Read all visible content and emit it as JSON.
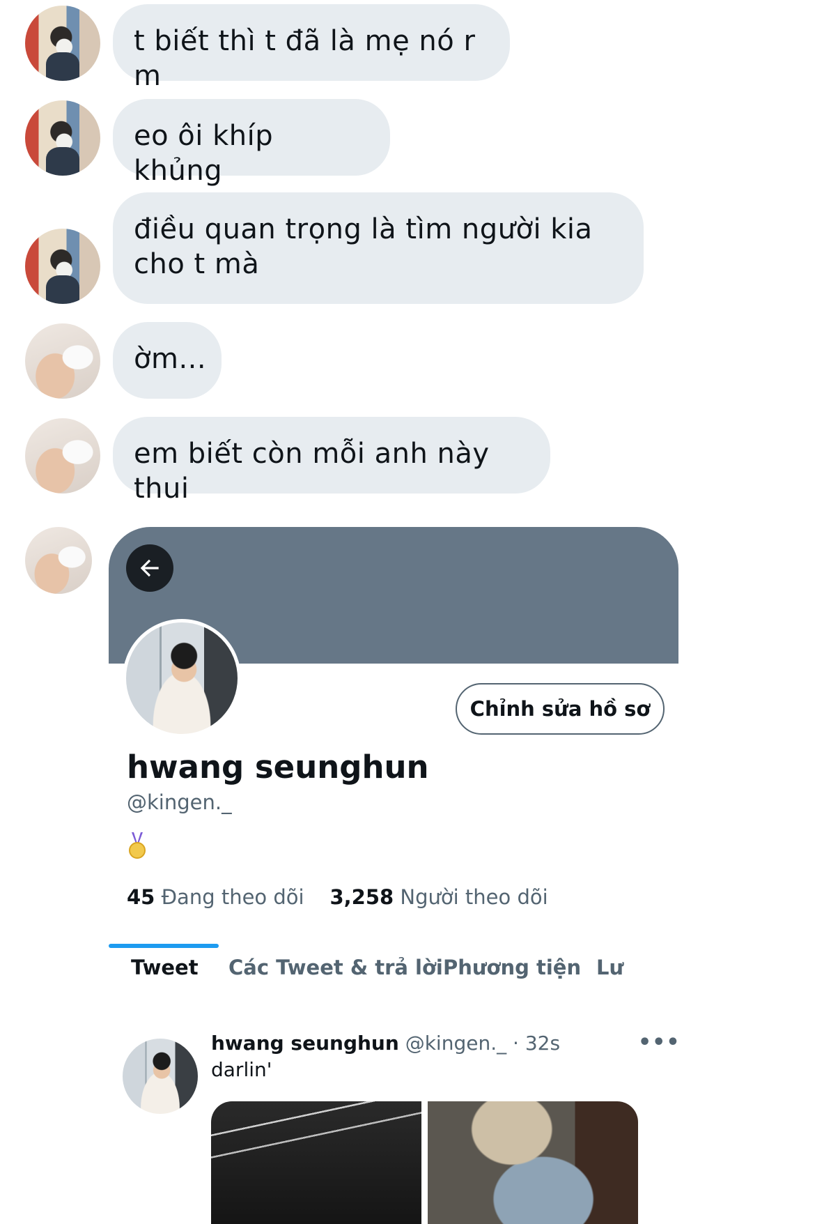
{
  "messages": [
    {
      "sender": "a",
      "text": "t biết thì t đã là mẹ nó r m"
    },
    {
      "sender": "a",
      "text": "eo ôi khíp khủng"
    },
    {
      "sender": "a",
      "text": "điều quan trọng là tìm người kia\ncho t mà"
    },
    {
      "sender": "b",
      "text": "ờm..."
    },
    {
      "sender": "b",
      "text": "em biết còn mỗi anh này thui"
    }
  ],
  "profile": {
    "edit_button": "Chỉnh sửa hồ sơ",
    "display_name": "hwang seunghun",
    "handle": "@kingen._",
    "bio_icon": "medal-icon",
    "following_count": "45",
    "following_label": "Đang theo dõi",
    "followers_count": "3,258",
    "followers_label": "Người theo dõi",
    "banner_color": "#667787"
  },
  "tabs": [
    {
      "label": "Tweet",
      "active": true
    },
    {
      "label": "Các Tweet & trả lời",
      "active": false
    },
    {
      "label": "Phương tiện",
      "active": false
    },
    {
      "label": "Lư",
      "active": false
    }
  ],
  "tweet": {
    "name": "hwang seunghun",
    "handle": "@kingen._",
    "sep": "·",
    "time": "32s",
    "text": "darlin'",
    "more_icon": "more-icon"
  },
  "colors": {
    "bubble": "#e7ecf0",
    "accent": "#1d9bf0",
    "secondary_text": "#536471"
  }
}
